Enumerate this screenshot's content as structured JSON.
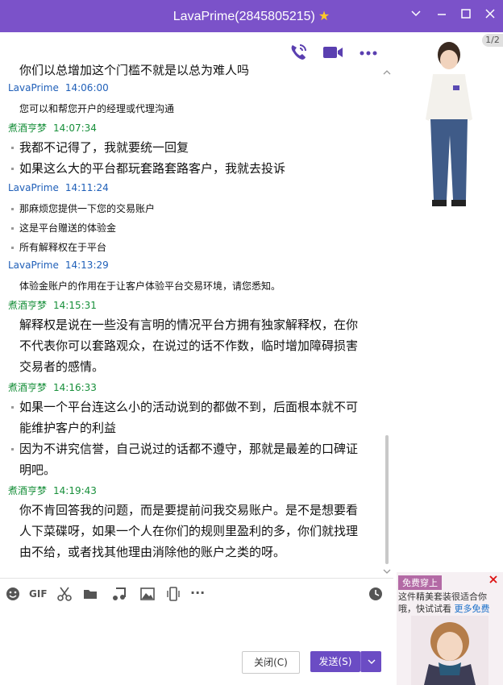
{
  "window": {
    "title": "LavaPrime(2845805215)",
    "page_badge": "1/2"
  },
  "header_icons": [
    "phone-icon",
    "video-icon",
    "more-icon"
  ],
  "messages": [
    {
      "type": "clipped",
      "text": "你们以总增加这个门槛不就是以总为难人吗"
    },
    {
      "type": "head",
      "sender": "LavaPrime",
      "time": "14:06:00",
      "color": "#1f5fb8"
    },
    {
      "type": "line",
      "size": "small",
      "bullet": false,
      "text": "您可以和帮您开户的经理或代理沟通"
    },
    {
      "type": "head",
      "sender": "煮酒亨梦",
      "time": "14:07:34",
      "color": "#178f3a"
    },
    {
      "type": "line",
      "size": "large",
      "bullet": true,
      "text": "我都不记得了，我就要统一回复"
    },
    {
      "type": "line",
      "size": "large",
      "bullet": true,
      "text": "如果这么大的平台都玩套路套路客户，我就去投诉"
    },
    {
      "type": "head",
      "sender": "LavaPrime",
      "time": "14:11:24",
      "color": "#1f5fb8"
    },
    {
      "type": "line",
      "size": "small",
      "bullet": true,
      "text": "那麻烦您提供一下您的交易账户"
    },
    {
      "type": "line",
      "size": "small",
      "bullet": true,
      "text": "这是平台赠送的体验金"
    },
    {
      "type": "line",
      "size": "small",
      "bullet": true,
      "text": "所有解释权在于平台"
    },
    {
      "type": "head",
      "sender": "LavaPrime",
      "time": "14:13:29",
      "color": "#1f5fb8"
    },
    {
      "type": "line",
      "size": "small",
      "bullet": false,
      "text": "体验金账户的作用在于让客户体验平台交易环境，请您悉知。"
    },
    {
      "type": "head",
      "sender": "煮酒亨梦",
      "time": "14:15:31",
      "color": "#178f3a"
    },
    {
      "type": "line",
      "size": "large",
      "bullet": false,
      "text": "解释权是说在一些没有言明的情况平台方拥有独家解释权，在你"
    },
    {
      "type": "line",
      "size": "large",
      "bullet": false,
      "text": "不代表你可以套路观众，在说过的话不作数，临时增加障碍损害"
    },
    {
      "type": "line",
      "size": "large",
      "bullet": false,
      "text": "交易者的感情。"
    },
    {
      "type": "head",
      "sender": "煮酒亨梦",
      "time": "14:16:33",
      "color": "#178f3a"
    },
    {
      "type": "line",
      "size": "large",
      "bullet": true,
      "text": "如果一个平台连这么小的活动说到的都做不到，后面根本就不可"
    },
    {
      "type": "line",
      "size": "large",
      "bullet": false,
      "text": "能维护客户的利益"
    },
    {
      "type": "line",
      "size": "large",
      "bullet": true,
      "text": "因为不讲究信誉，自己说过的话都不遵守，那就是最差的口碑证"
    },
    {
      "type": "line",
      "size": "large",
      "bullet": false,
      "text": "明吧。"
    },
    {
      "type": "head",
      "sender": "煮酒亨梦",
      "time": "14:19:43",
      "color": "#178f3a"
    },
    {
      "type": "line",
      "size": "large",
      "bullet": false,
      "text": "你不肯回答我的问题，而是要提前问我交易账户。是不是想要看"
    },
    {
      "type": "line",
      "size": "large",
      "bullet": false,
      "text": "人下菜碟呀，如果一个人在你们的规则里盈利的多，你们就找理"
    },
    {
      "type": "line",
      "size": "large",
      "bullet": false,
      "text": "由不给，或者找其他理由消除他的账户之类的呀。"
    }
  ],
  "toolbar": {
    "gif_label": "GIF",
    "more_label": "···"
  },
  "buttons": {
    "close_label": "关闭(C)",
    "send_label": "发送(S)"
  },
  "ad": {
    "badge": "免费穿上",
    "text1": "这件精美套装很适合你",
    "text2_prefix": "哦，快试试看 ",
    "text2_link": "更多免费"
  },
  "colors": {
    "titlebar": "#7b52c9",
    "lavaprime": "#1f5fb8",
    "customer": "#178f3a",
    "send_button": "#6b4cc4"
  }
}
